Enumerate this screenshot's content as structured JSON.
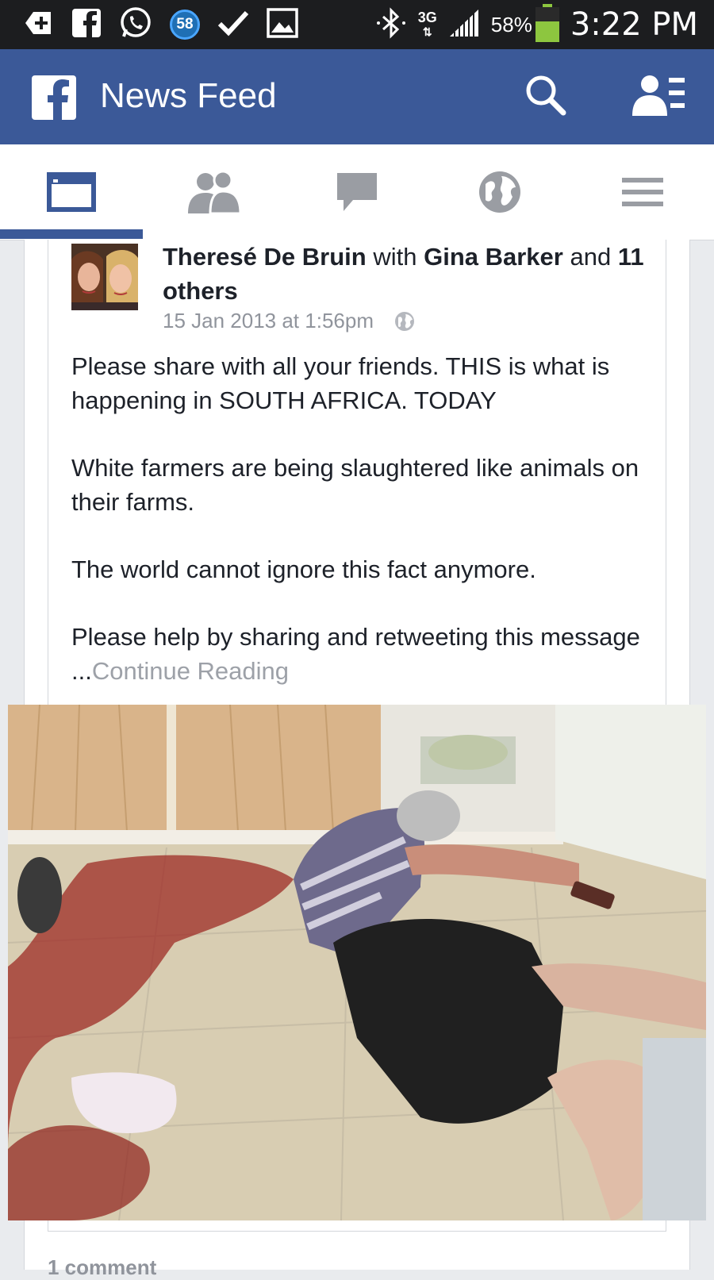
{
  "status_bar": {
    "notification_badge": "58",
    "network": "3G",
    "battery_percent": "58%",
    "time": "3:22 PM",
    "icons": [
      "add-icon",
      "facebook-icon",
      "whatsapp-icon",
      "notification-count-badge",
      "check-icon",
      "gallery-icon",
      "bluetooth-icon",
      "signal-icon",
      "battery-icon"
    ]
  },
  "top_bar": {
    "title": "News Feed",
    "brand_color": "#3b5998"
  },
  "tabs": [
    {
      "name": "news-feed",
      "icon": "news-feed-icon",
      "active": true
    },
    {
      "name": "friend-requests",
      "icon": "friends-icon",
      "active": false
    },
    {
      "name": "messages",
      "icon": "chat-icon",
      "active": false
    },
    {
      "name": "notifications",
      "icon": "globe-icon",
      "active": false
    },
    {
      "name": "more",
      "icon": "menu-icon",
      "active": false
    }
  ],
  "post": {
    "author": "Theresé De Bruin",
    "with_text": "with",
    "tagged": "Gina Barker",
    "and_text": "and",
    "others": "11 others",
    "timestamp": "15 Jan 2013 at 1:56pm",
    "paragraphs": [
      "Please share with all your friends. THIS is what is happening in SOUTH AFRICA. TODAY",
      "White farmers are being slaughtered like animals on their farms.",
      "The world cannot ignore this fact anymore."
    ],
    "last_paragraph": "Please help by sharing and retweeting this message ...",
    "continue_label": "Continue Reading",
    "comments_count": "1 comment"
  }
}
